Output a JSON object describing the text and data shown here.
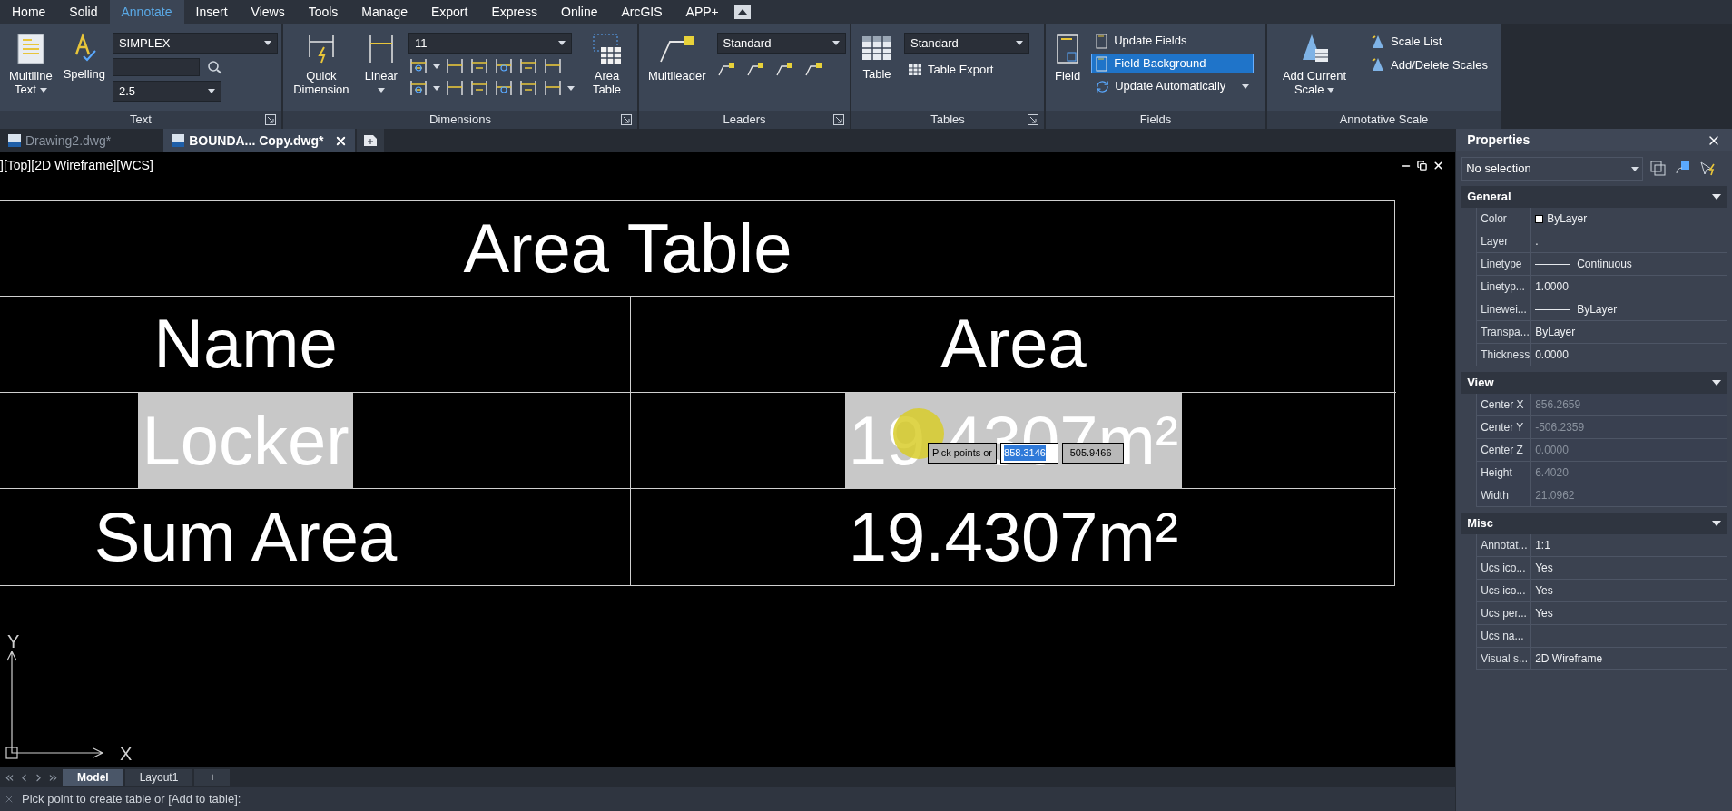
{
  "menu_tabs": [
    {
      "label": "Home",
      "selected": false
    },
    {
      "label": "Solid",
      "selected": false
    },
    {
      "label": "Annotate",
      "selected": true
    },
    {
      "label": "Insert",
      "selected": false
    },
    {
      "label": "Views",
      "selected": false
    },
    {
      "label": "Tools",
      "selected": false
    },
    {
      "label": "Manage",
      "selected": false
    },
    {
      "label": "Export",
      "selected": false
    },
    {
      "label": "Express",
      "selected": false
    },
    {
      "label": "Online",
      "selected": false
    },
    {
      "label": "ArcGIS",
      "selected": false
    },
    {
      "label": "APP+",
      "selected": false
    }
  ],
  "ribbon": {
    "panels": [
      {
        "kind": "text",
        "title": "Text",
        "launcher": true,
        "buttons": [
          {
            "label": "Multiline Text",
            "dropdown": true
          },
          {
            "label": "Spelling",
            "dropdown": false
          }
        ],
        "font_dropdown": "SIMPLEX",
        "height_dropdown": "2.5"
      },
      {
        "kind": "dimensions",
        "title": "Dimensions",
        "launcher": true,
        "buttons": [
          {
            "label": "Quick Dimension",
            "dropdown": false
          },
          {
            "label": "Linear",
            "dropdown": true
          },
          {
            "label": "Area Table",
            "dropdown": false
          }
        ],
        "style_dropdown": "11"
      },
      {
        "kind": "leaders",
        "title": "Leaders",
        "launcher": true,
        "buttons": [
          {
            "label": "Multileader",
            "dropdown": false
          }
        ],
        "style_dropdown": "Standard"
      },
      {
        "kind": "tables",
        "title": "Tables",
        "launcher": true,
        "buttons": [
          {
            "label": "Table",
            "dropdown": false
          }
        ],
        "style_dropdown": "Standard",
        "items": [
          {
            "label": "Table Export",
            "selected": false
          }
        ]
      },
      {
        "kind": "fields",
        "title": "Fields",
        "launcher": false,
        "buttons": [
          {
            "label": "Field",
            "dropdown": false
          }
        ],
        "items": [
          {
            "label": "Update Fields",
            "selected": false,
            "dropdown": false
          },
          {
            "label": "Field Background",
            "selected": true,
            "dropdown": false
          },
          {
            "label": "Update Automatically",
            "selected": false,
            "dropdown": true
          }
        ]
      },
      {
        "kind": "scale",
        "title": "Annotative Scale",
        "launcher": false,
        "buttons": [
          {
            "label": "Add Current Scale",
            "dropdown": true
          }
        ],
        "items": [
          {
            "label": "Scale List",
            "selected": false
          },
          {
            "label": "Add/Delete Scales",
            "selected": false
          }
        ]
      }
    ]
  },
  "document_tabs": [
    {
      "label": "Drawing2.dwg*",
      "selected": false
    },
    {
      "label": "BOUNDA... Copy.dwg*",
      "selected": true
    }
  ],
  "viewport_label": "][Top][2D Wireframe][WCS]",
  "drawing_table": {
    "title": "Area Table",
    "header": [
      "Name",
      "Area"
    ],
    "rows": [
      {
        "cells": [
          "Locker",
          "19.4307m²"
        ],
        "highlighted": true
      },
      {
        "cells": [
          "Sum Area",
          "19.4307m²"
        ],
        "highlighted": false
      }
    ]
  },
  "input_tooltip": {
    "prompt": "Pick points or",
    "x_value": "858.3146",
    "x_selected": true,
    "y_value": "-505.9466"
  },
  "ucs": {
    "y_label": "Y",
    "x_label": "X"
  },
  "layout_tabs": [
    {
      "label": "Model",
      "selected": true
    },
    {
      "label": "Layout1",
      "selected": false
    },
    {
      "label": "+",
      "selected": false
    }
  ],
  "command_line": "Pick point to create table or [Add to table]:",
  "properties": {
    "title": "Properties",
    "selection": "No selection",
    "sections": [
      {
        "title": "General",
        "expanded": true,
        "rows": [
          {
            "kind": "color",
            "label": "Color",
            "value": "ByLayer",
            "disabled": false
          },
          {
            "kind": "text",
            "label": "Layer",
            "value": ".",
            "disabled": false
          },
          {
            "kind": "line",
            "label": "Linetype",
            "value": "Continuous",
            "disabled": false
          },
          {
            "kind": "text",
            "label": "Linetyp...",
            "value": "1.0000",
            "disabled": false
          },
          {
            "kind": "line",
            "label": "Linewei...",
            "value": "ByLayer",
            "disabled": false
          },
          {
            "kind": "text",
            "label": "Transpa...",
            "value": "ByLayer",
            "disabled": false
          },
          {
            "kind": "text",
            "label": "Thickness",
            "value": "0.0000",
            "disabled": false
          }
        ]
      },
      {
        "title": "View",
        "expanded": true,
        "rows": [
          {
            "kind": "text",
            "label": "Center X",
            "value": "856.2659",
            "disabled": true
          },
          {
            "kind": "text",
            "label": "Center Y",
            "value": "-506.2359",
            "disabled": true
          },
          {
            "kind": "text",
            "label": "Center Z",
            "value": "0.0000",
            "disabled": true
          },
          {
            "kind": "text",
            "label": "Height",
            "value": "6.4020",
            "disabled": true
          },
          {
            "kind": "text",
            "label": "Width",
            "value": "21.0962",
            "disabled": true
          }
        ]
      },
      {
        "title": "Misc",
        "expanded": true,
        "rows": [
          {
            "kind": "text",
            "label": "Annotat...",
            "value": "1:1",
            "disabled": false
          },
          {
            "kind": "text",
            "label": "Ucs ico...",
            "value": "Yes",
            "disabled": false
          },
          {
            "kind": "text",
            "label": "Ucs ico...",
            "value": "Yes",
            "disabled": false
          },
          {
            "kind": "text",
            "label": "Ucs per...",
            "value": "Yes",
            "disabled": false
          },
          {
            "kind": "text",
            "label": "Ucs na...",
            "disabled": false
          },
          {
            "kind": "text",
            "label": "Visual s...",
            "value": "2D Wireframe",
            "disabled": false
          }
        ]
      }
    ]
  }
}
